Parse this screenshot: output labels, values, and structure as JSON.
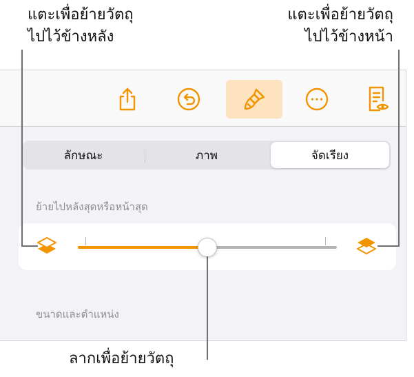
{
  "callouts": {
    "left_line1": "แตะเพื่อย้ายวัตถุ",
    "left_line2": "ไปไว้ข้างหลัง",
    "right_line1": "แตะเพื่อย้ายวัตถุ",
    "right_line2": "ไปไว้ข้างหน้า",
    "bottom": "ลากเพื่อย้ายวัตถุ"
  },
  "toolbar": {
    "icons": [
      "share-icon",
      "undo-icon",
      "paintbrush-icon",
      "more-icon",
      "reader-view-icon"
    ],
    "active": "paintbrush-icon",
    "accent": "#f29400",
    "active_bg": "#fde3bf"
  },
  "tabs": {
    "items": [
      "ลักษณะ",
      "ภาพ",
      "จัดเรียง"
    ],
    "selected": "จัดเรียง"
  },
  "arrange": {
    "section_label": "ย้ายไปหลังสุดหรือหน้าสุด",
    "slider_value": 0.5,
    "send_back_icon": "layers-back-icon",
    "bring_front_icon": "layers-front-icon"
  },
  "size_position": {
    "section_label": "ขนาดและตำแหน่ง"
  }
}
